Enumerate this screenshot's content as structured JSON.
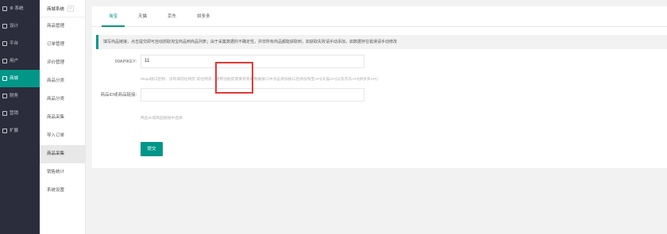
{
  "sidebar": {
    "items": [
      {
        "label": "⚙ 系统",
        "active": false
      },
      {
        "label": "设计",
        "active": false
      },
      {
        "label": "平台",
        "active": false
      },
      {
        "label": "用户",
        "active": false
      },
      {
        "label": "商城",
        "active": true
      },
      {
        "label": "财务",
        "active": false
      },
      {
        "label": "营销",
        "active": false
      },
      {
        "label": "扩展",
        "active": false
      }
    ]
  },
  "subnav": {
    "title": "商城系统",
    "collapse": "<",
    "items": [
      {
        "label": "商品管理",
        "active": false
      },
      {
        "label": "订单管理",
        "active": false
      },
      {
        "label": "评价管理",
        "active": false
      },
      {
        "label": "商品分类",
        "active": false
      },
      {
        "label": "商品分类",
        "active": false
      },
      {
        "label": "商品采集",
        "active": false
      },
      {
        "label": "导入订单",
        "active": false
      },
      {
        "label": "商品采集",
        "active": true
      },
      {
        "label": "销售统计",
        "active": false
      },
      {
        "label": "系统设置",
        "active": false
      }
    ]
  },
  "tabs": [
    "淘宝",
    "天猫",
    "京东",
    "拼多多"
  ],
  "notice": "填写商品链接，点击提交即可自动抓取淘宝商品到商品列表；由于采集数据的不确定性，并非所有商品都能获取到，如获取失败请手动添加，如数据存在错误请手动修改",
  "form": {
    "apikey_label": "99APIKEY:",
    "apikey_value": "11",
    "apikey_help": "99api接口密钥，没有请前往网页 前往购买，使用功能前需要有有的数据接口中点击添加接口后添加淘宝API[天猫API]以及京东API[拼多多API]",
    "url_label": "商品ID或商品链接:",
    "url_value": "",
    "url_help": "商品ID或商品链接中选择",
    "submit": "提交"
  }
}
